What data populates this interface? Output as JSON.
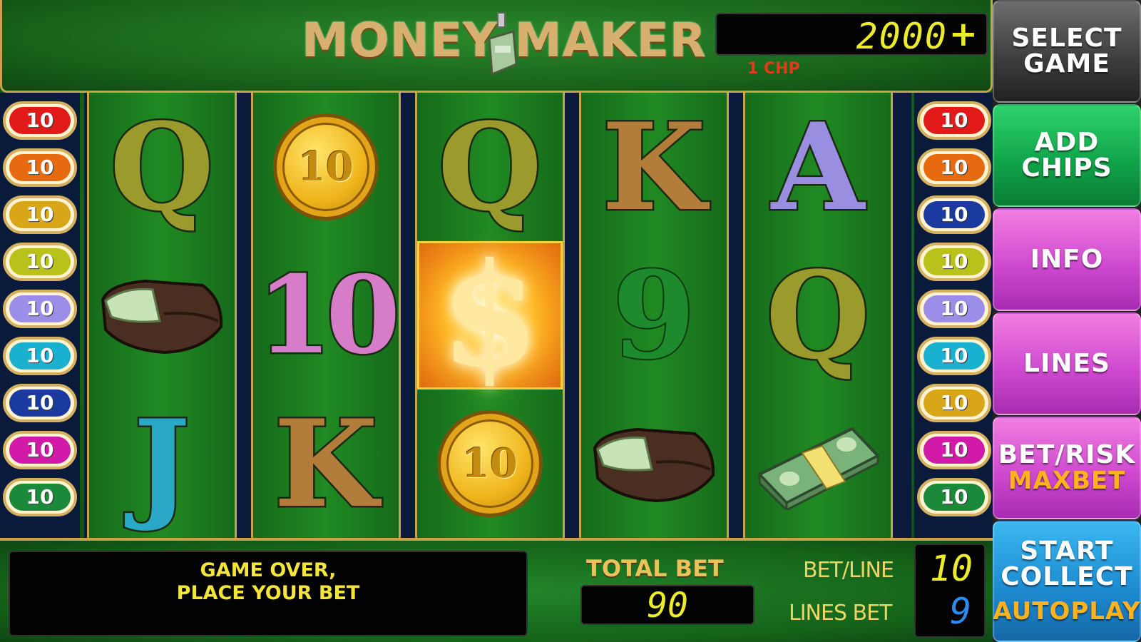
{
  "header": {
    "title": "MONEY MAKER",
    "credit": "2000",
    "credit_plus": "+",
    "chip_label": "1 CHP"
  },
  "reels": [
    [
      "Q",
      "10-coin",
      "Q",
      "K",
      "A"
    ],
    [
      "wallet",
      "10",
      "dollar",
      "9",
      "Q"
    ],
    [
      "J",
      "K",
      "10-coin",
      "wallet",
      "cash-stack"
    ]
  ],
  "symbols": {
    "r1c1": "Q",
    "r1c2": "10",
    "r1c3": "Q",
    "r1c4": "K",
    "r1c5": "A",
    "r2c2": "10",
    "r2c3": "$",
    "r2c4": "9",
    "r2c5": "Q",
    "r3c1": "J",
    "r3c2": "K",
    "r3c3": "10"
  },
  "left_lines": [
    "10",
    "10",
    "10",
    "10",
    "10",
    "10",
    "10",
    "10",
    "10"
  ],
  "right_lines": [
    "10",
    "10",
    "10",
    "10",
    "10",
    "10",
    "10",
    "10",
    "10"
  ],
  "line_colors_left": [
    "#e21a1a",
    "#e86a10",
    "#d9a61a",
    "#b9c21a",
    "#9a8ee8",
    "#1ab0d0",
    "#1a3aa0",
    "#d21aa8",
    "#1a8a3a"
  ],
  "line_colors_right": [
    "#e21a1a",
    "#e86a10",
    "#1a3aa0",
    "#b9c21a",
    "#9a8ee8",
    "#1ab0d0",
    "#d9a61a",
    "#d21aa8",
    "#1a8a3a"
  ],
  "bottom": {
    "message_line1": "GAME OVER,",
    "message_line2": "PLACE YOUR BET",
    "total_bet_label": "TOTAL BET",
    "total_bet": "90",
    "bet_line_label": "BET/LINE",
    "bet_line": "10",
    "lines_bet_label": "LINES BET",
    "lines_bet": "9"
  },
  "menu": {
    "select_game_1": "SELECT",
    "select_game_2": "GAME",
    "add_chips_1": "ADD",
    "add_chips_2": "CHIPS",
    "info": "INFO",
    "lines": "LINES",
    "bet_risk": "BET/RISK",
    "maxbet": "MAXBET",
    "start": "START",
    "collect": "COLLECT",
    "autoplay": "AUTOPLAY"
  }
}
